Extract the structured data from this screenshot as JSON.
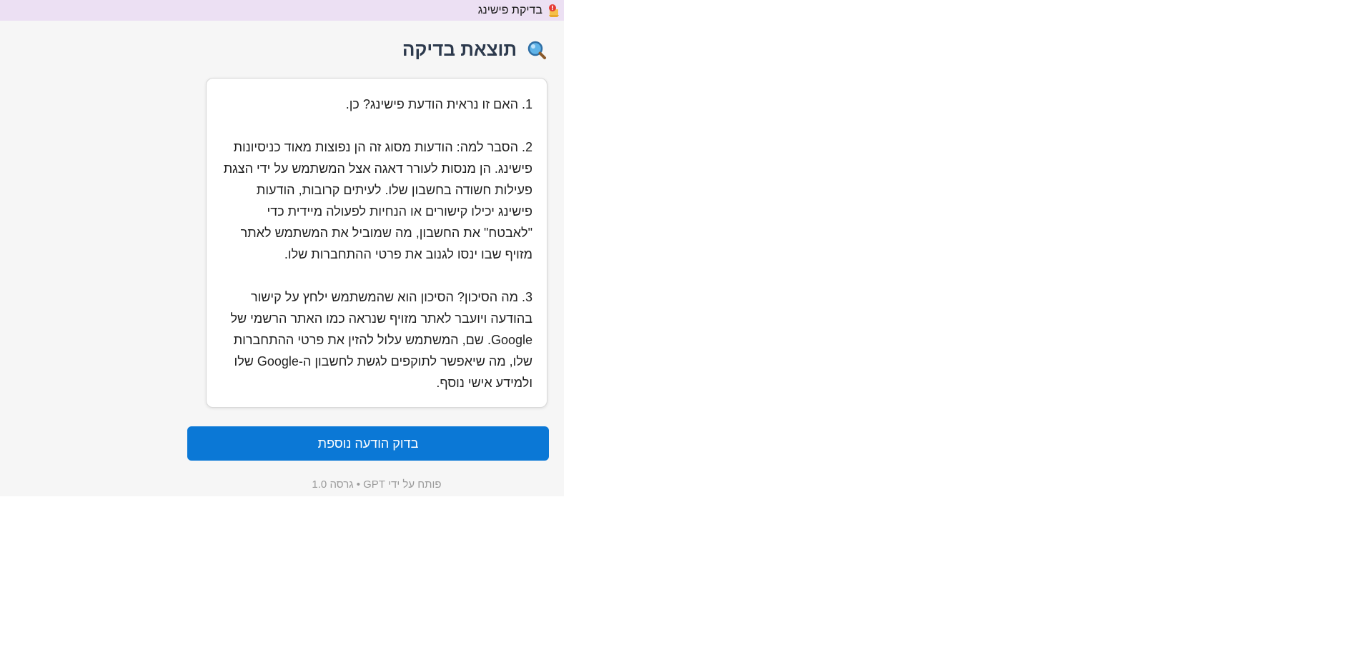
{
  "app": {
    "title": "בדיקת פישינג",
    "icon": "phishing-alert-icon"
  },
  "result": {
    "heading": "תוצאת בדיקה",
    "heading_icon": "magnifier-icon",
    "paragraphs": [
      "1. האם זו נראית הודעת פישינג? כן.",
      "2. הסבר למה: הודעות מסוג זה הן נפוצות מאוד כניסיונות פישינג. הן מנסות לעורר דאגה אצל המשתמש על ידי הצגת פעילות חשודה בחשבון שלו. לעיתים קרובות, הודעות פישינג יכילו קישורים או הנחיות לפעולה מיידית כדי \"לאבטח\" את החשבון, מה שמוביל את המשתמש לאתר מזויף שבו ינסו לגנוב את פרטי ההתחברות שלו.",
      "3. מה הסיכון? הסיכון הוא שהמשתמש ילחץ על קישור בהודעה ויועבר לאתר מזויף שנראה כמו האתר הרשמי של Google. שם, המשתמש עלול להזין את פרטי ההתחברות שלו, מה שיאפשר לתוקפים לגשת לחשבון ה-Google שלו ולמידע אישי נוסף."
    ]
  },
  "actions": {
    "check_again_label": "בדוק הודעה נוספת"
  },
  "footer": {
    "text": "פותח על ידי GPT • גרסה 1.0"
  },
  "colors": {
    "titlebar_bg": "#ece0f3",
    "panel_bg": "#f6f6f6",
    "button_bg": "#0b78d6",
    "heading": "#2d3a4d"
  }
}
